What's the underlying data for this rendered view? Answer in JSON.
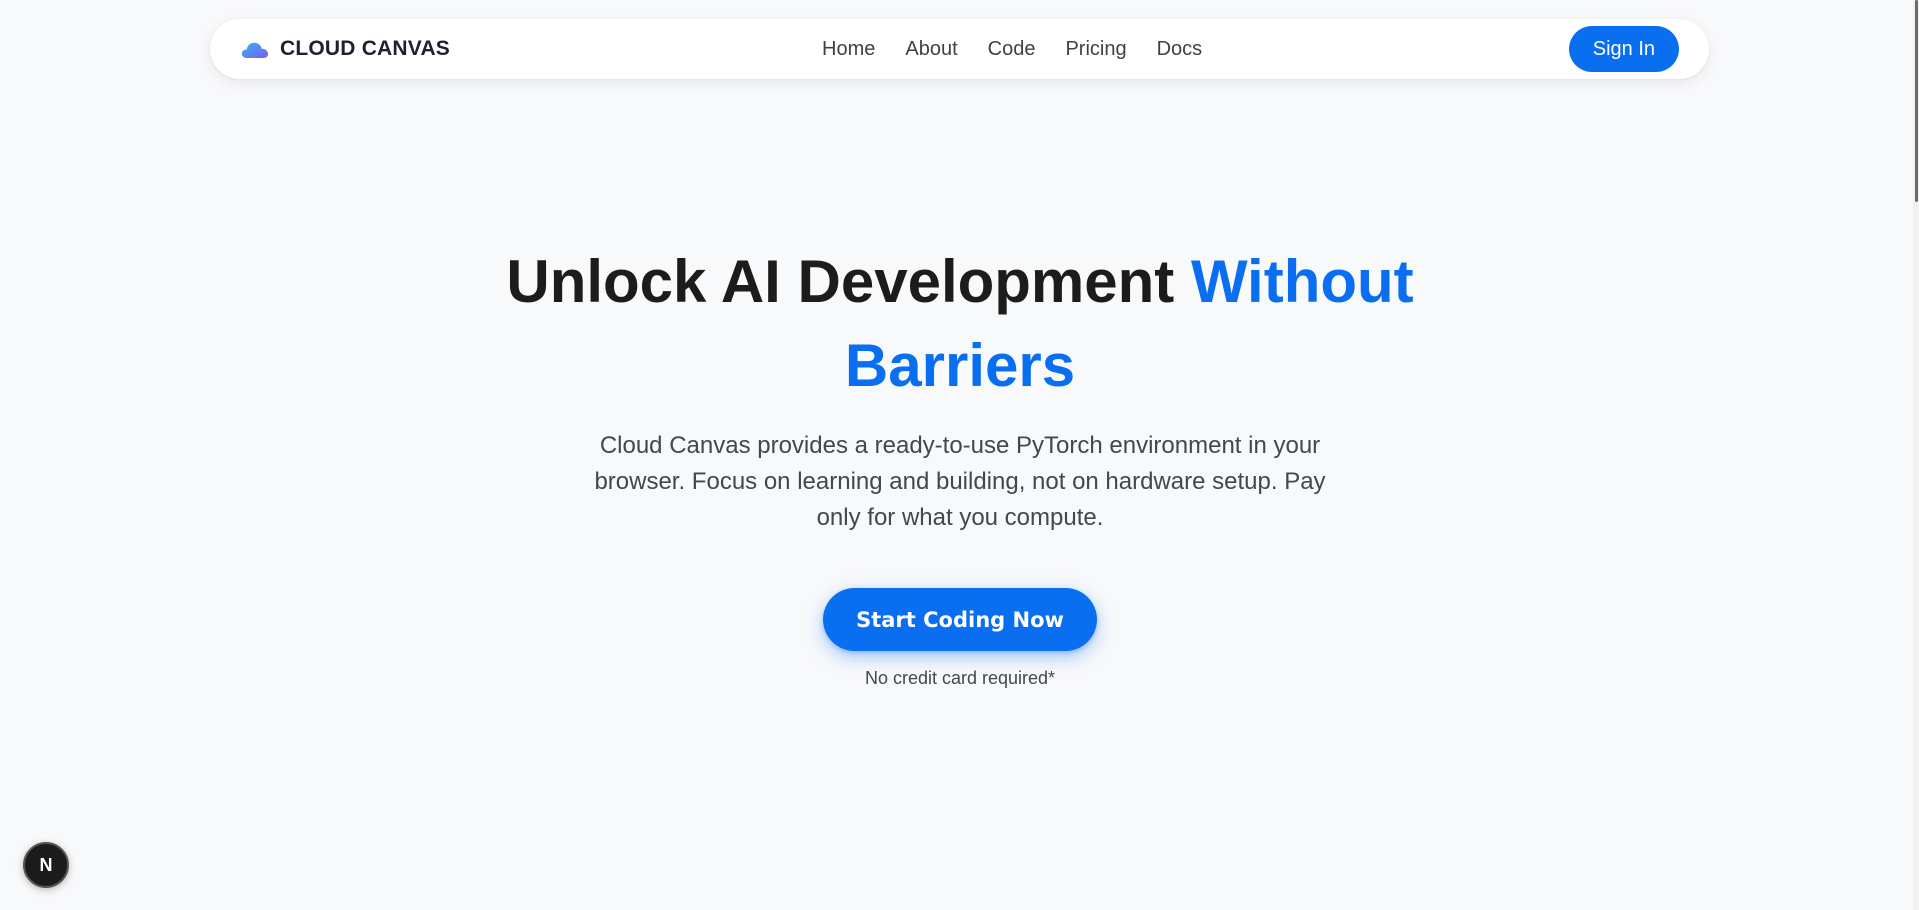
{
  "brand": {
    "name": "CLOUD CANVAS",
    "icon": "cloud-icon",
    "colors": {
      "gradient_start": "#33b5f5",
      "gradient_end": "#7b5cf0"
    }
  },
  "nav": {
    "links": [
      {
        "label": "Home"
      },
      {
        "label": "About"
      },
      {
        "label": "Code"
      },
      {
        "label": "Pricing"
      },
      {
        "label": "Docs"
      }
    ],
    "signin_label": "Sign In"
  },
  "hero": {
    "title_main": "Unlock AI Development",
    "title_accent": "Without Barriers",
    "subtitle": "Cloud Canvas provides a ready-to-use PyTorch environment in your browser. Focus on learning and building, not on hardware setup. Pay only for what you compute.",
    "cta_label": "Start Coding Now",
    "cta_note": "No credit card required*"
  },
  "badge": {
    "label": "N"
  },
  "colors": {
    "accent": "#0a6ef0",
    "background": "#f8f9fb",
    "text_dark": "#1c1c1c",
    "text_muted": "#444650"
  }
}
